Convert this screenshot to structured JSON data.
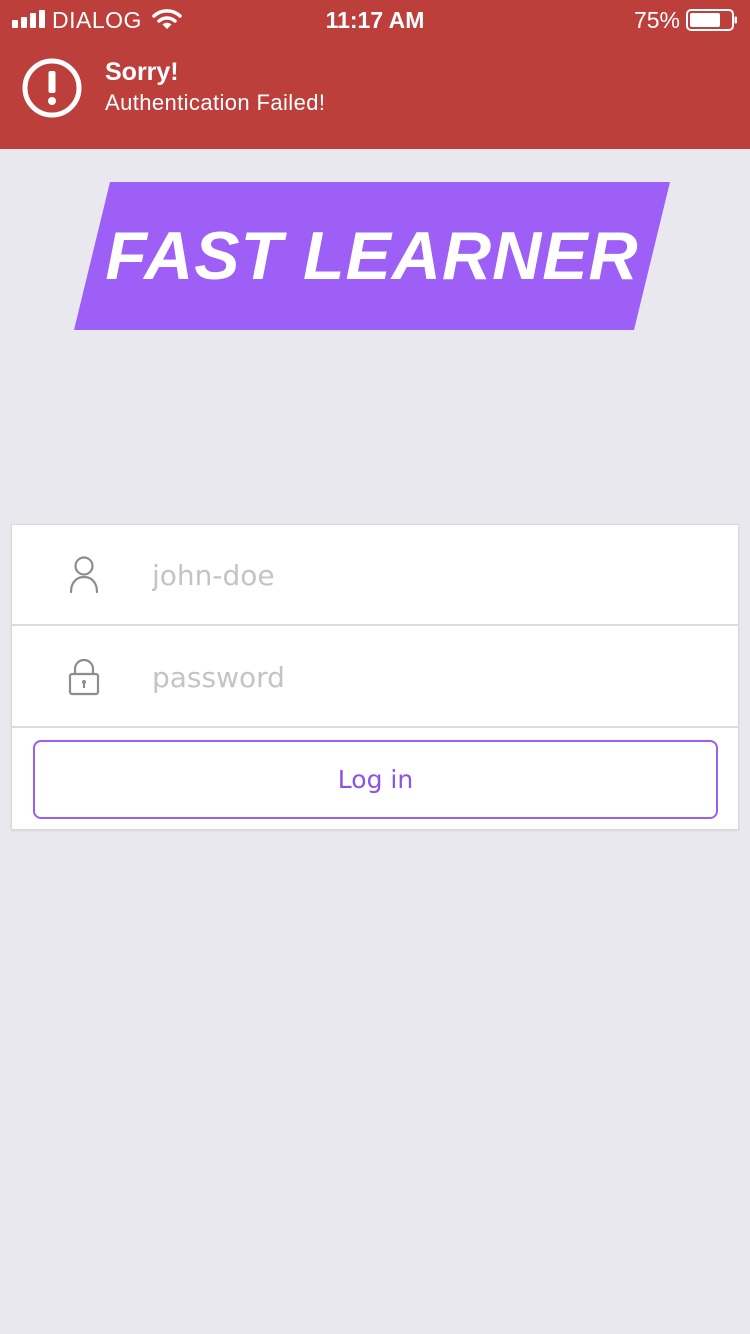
{
  "status_bar": {
    "carrier": "DIALOG",
    "time": "11:17 AM",
    "battery_percent": "75%",
    "battery_level": 0.75,
    "signal_icon": "signal-icon",
    "wifi_icon": "wifi-icon",
    "battery_icon": "battery-icon"
  },
  "alert": {
    "icon": "alert-icon",
    "title": "Sorry!",
    "message": "Authentication Failed!",
    "background_color": "#bd3f3b"
  },
  "logo": {
    "text": "FAST LEARNER",
    "color": "#9e5ff6"
  },
  "login_form": {
    "username": {
      "icon": "user-icon",
      "value": "",
      "placeholder": "john-doe"
    },
    "password": {
      "icon": "lock-icon",
      "value": "",
      "placeholder": "password"
    },
    "login_label": "Log in",
    "accent_color": "#9a5ef0"
  }
}
